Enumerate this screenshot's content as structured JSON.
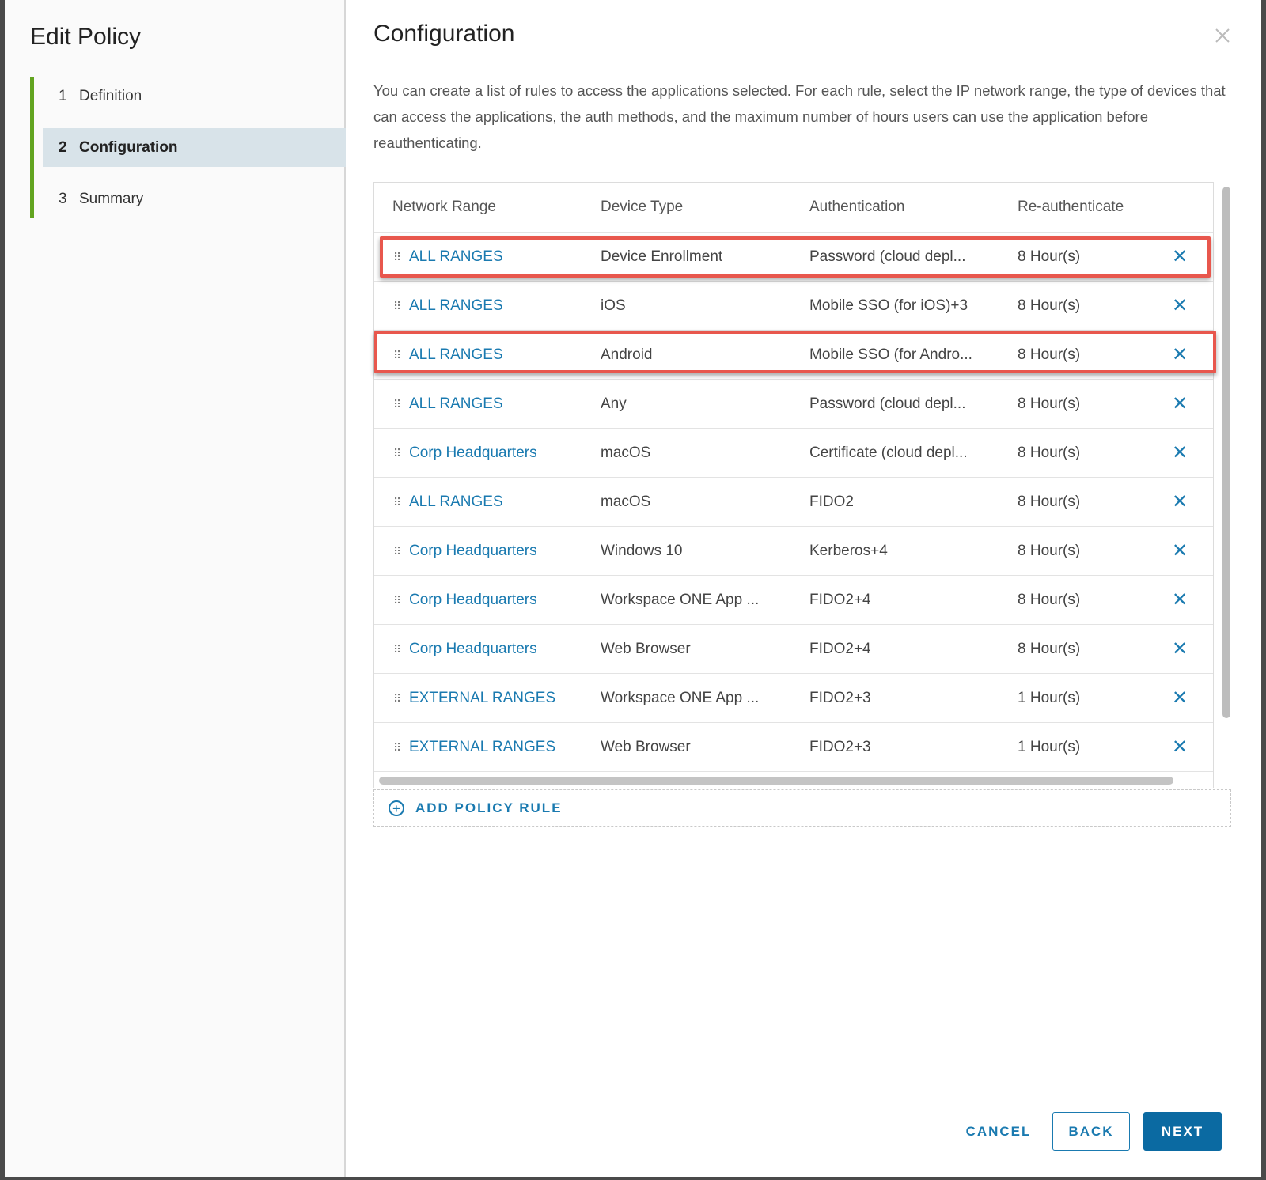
{
  "sidebar": {
    "title": "Edit Policy",
    "steps": [
      {
        "num": "1",
        "label": "Definition"
      },
      {
        "num": "2",
        "label": "Configuration"
      },
      {
        "num": "3",
        "label": "Summary"
      }
    ]
  },
  "main": {
    "title": "Configuration",
    "description": "You can create a list of rules to access the applications selected. For each rule, select the IP network range, the type of devices that can access the applications, the auth methods, and the maximum number of hours users can use the application before reauthenticating.",
    "close_icon": "close-icon"
  },
  "table": {
    "headers": [
      "Network Range",
      "Device Type",
      "Authentication",
      "Re-authenticate"
    ],
    "rows": [
      {
        "range": "ALL RANGES",
        "device": "Device Enrollment",
        "auth": "Password (cloud depl...",
        "reauth": "8 Hour(s)"
      },
      {
        "range": "ALL RANGES",
        "device": "iOS",
        "auth": "Mobile SSO (for iOS)+3",
        "reauth": "8 Hour(s)"
      },
      {
        "range": "ALL RANGES",
        "device": "Android",
        "auth": "Mobile SSO (for Andro...",
        "reauth": "8 Hour(s)"
      },
      {
        "range": "ALL RANGES",
        "device": "Any",
        "auth": "Password (cloud depl...",
        "reauth": "8 Hour(s)"
      },
      {
        "range": "Corp Headquarters",
        "device": "macOS",
        "auth": "Certificate (cloud depl...",
        "reauth": "8 Hour(s)"
      },
      {
        "range": "ALL RANGES",
        "device": "macOS",
        "auth": "FIDO2",
        "reauth": "8 Hour(s)"
      },
      {
        "range": "Corp Headquarters",
        "device": "Windows 10",
        "auth": "Kerberos+4",
        "reauth": "8 Hour(s)"
      },
      {
        "range": "Corp Headquarters",
        "device": "Workspace ONE App ...",
        "auth": "FIDO2+4",
        "reauth": "8 Hour(s)"
      },
      {
        "range": "Corp Headquarters",
        "device": "Web Browser",
        "auth": "FIDO2+4",
        "reauth": "8 Hour(s)"
      },
      {
        "range": "EXTERNAL RANGES",
        "device": "Workspace ONE App ...",
        "auth": "FIDO2+3",
        "reauth": "1 Hour(s)"
      },
      {
        "range": "EXTERNAL RANGES",
        "device": "Web Browser",
        "auth": "FIDO2+3",
        "reauth": "1 Hour(s)"
      }
    ],
    "delete_glyph": "✕",
    "handle_glyph": "⠿"
  },
  "add_rule_label": "ADD POLICY RULE",
  "footer": {
    "cancel": "CANCEL",
    "back": "BACK",
    "next": "NEXT"
  },
  "colors": {
    "accent": "#1a7ab0",
    "step_indicator": "#62a420",
    "highlight": "#e8574d",
    "primary_button": "#0b6aa2"
  }
}
